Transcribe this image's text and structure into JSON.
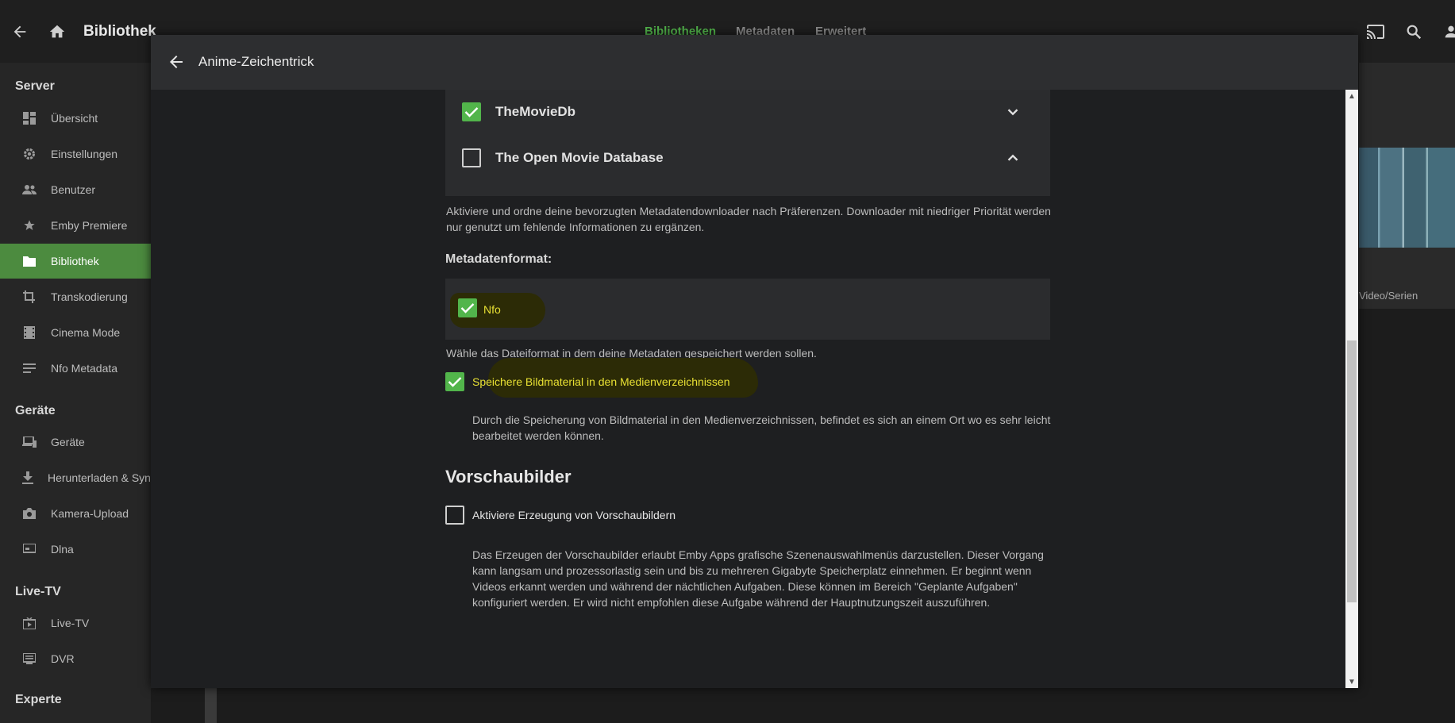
{
  "topbar": {
    "title": "Bibliothek",
    "tabs": [
      {
        "label": "Bibliotheken",
        "active": true
      },
      {
        "label": "Metadaten",
        "active": false
      },
      {
        "label": "Erweitert",
        "active": false
      }
    ]
  },
  "sidebar": {
    "sections": [
      {
        "title": "Server",
        "items": [
          {
            "label": "Übersicht",
            "icon": "dashboard-icon"
          },
          {
            "label": "Einstellungen",
            "icon": "gear-icon"
          },
          {
            "label": "Benutzer",
            "icon": "users-icon"
          },
          {
            "label": "Emby Premiere",
            "icon": "star-icon"
          },
          {
            "label": "Bibliothek",
            "icon": "folder-icon",
            "active": true
          },
          {
            "label": "Transkodierung",
            "icon": "crop-icon"
          },
          {
            "label": "Cinema Mode",
            "icon": "film-icon"
          },
          {
            "label": "Nfo Metadata",
            "icon": "lines-icon"
          }
        ]
      },
      {
        "title": "Geräte",
        "items": [
          {
            "label": "Geräte",
            "icon": "devices-icon"
          },
          {
            "label": "Herunterladen & Sync",
            "icon": "download-icon"
          },
          {
            "label": "Kamera-Upload",
            "icon": "camera-icon"
          },
          {
            "label": "Dlna",
            "icon": "cast-screen-icon"
          }
        ]
      },
      {
        "title": "Live-TV",
        "items": [
          {
            "label": "Live-TV",
            "icon": "live-tv-icon"
          },
          {
            "label": "DVR",
            "icon": "dvr-icon"
          }
        ]
      },
      {
        "title": "Experte",
        "items": []
      }
    ]
  },
  "background": {
    "label": "Video/Serien"
  },
  "dialog": {
    "title": "Anime-Zeichentrick",
    "downloaders": [
      {
        "name": "TheMovieDb",
        "checked": true,
        "chevron": "chevron-down-icon"
      },
      {
        "name": "The Open Movie Database",
        "checked": false,
        "chevron": "chevron-up-icon"
      }
    ],
    "downloaders_help": "Aktiviere und ordne deine bevorzugten Metadatendownloader nach Präferenzen. Downloader mit niedriger Priorität werden nur genutzt um fehlende Informationen zu ergänzen.",
    "format_heading": "Metadatenformat:",
    "format_option": {
      "label": "Nfo",
      "checked": true
    },
    "format_help": "Wähle das Dateiformat in dem deine Metadaten gespeichert werden sollen.",
    "save_artwork": {
      "label": "Speichere Bildmaterial in den Medienverzeichnissen",
      "checked": true,
      "help": "Durch die Speicherung von Bildmaterial in den Medienverzeichnissen, befindet es sich an einem Ort wo es sehr leicht bearbeitet werden können."
    },
    "thumbnails_heading": "Vorschaubilder",
    "thumbnails": {
      "label": "Aktiviere Erzeugung von Vorschaubildern",
      "checked": false,
      "help": "Das Erzeugen der Vorschaubilder erlaubt Emby Apps grafische Szenenauswahlmenüs darzustellen. Dieser Vorgang kann langsam und prozessorlastig sein und bis zu mehreren Gigabyte Speicherplatz einnehmen. Er beginnt wenn Videos erkannt werden und während der nächtlichen Aufgaben. Diese können im Bereich \"Geplante Aufgaben\" konfiguriert werden. Er wird nicht empfohlen diese Aufgabe während der Hauptnutzungszeit auszuführen."
    }
  },
  "colors": {
    "accent": "#52b54b",
    "highlight_text": "#e8e033",
    "sidebar_active": "#4c8b3f"
  }
}
